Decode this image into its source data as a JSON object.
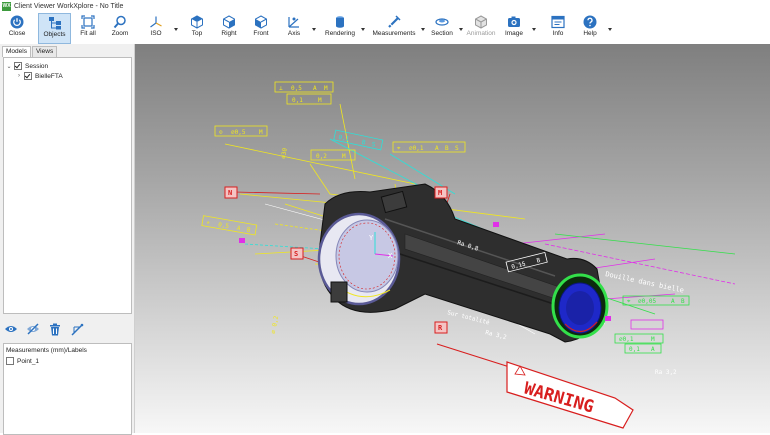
{
  "window": {
    "title": "Client Viewer WorkXplore - No Title",
    "logo_text": "WX"
  },
  "toolbar": {
    "close": "Close",
    "objects": "Objects",
    "fit_all": "Fit all",
    "zoom": "Zoom",
    "iso": "ISO",
    "top": "Top",
    "right": "Right",
    "front": "Front",
    "axis": "Axis",
    "rendering": "Rendering",
    "measurements": "Measurements",
    "section": "Section",
    "animation": "Animation",
    "image": "Image",
    "info": "Info",
    "help": "Help"
  },
  "left_panel": {
    "tabs": [
      "Models",
      "Views"
    ],
    "tree": [
      {
        "label": "Session",
        "checked": true
      },
      {
        "label": "BielleFTA",
        "checked": true
      }
    ],
    "measurements_header": "Measurements (mm)/Labels",
    "measurements": [
      {
        "label": "Point_1",
        "checked": false
      }
    ]
  },
  "viewport": {
    "labels": {
      "datum_n": "N",
      "datum_m": "M",
      "datum_s": "S",
      "datum_r": "R",
      "fcf1_a": "⊥",
      "fcf1_b": "0,5",
      "fcf1_c": "A",
      "fcf1_d": "M",
      "fcf2_a": "0,1",
      "fcf2_b": "M",
      "fcf3_a": "⊙",
      "fcf3_b": "⌀0,5",
      "fcf3_c": "M",
      "fcf4_a": "0,2",
      "fcf4_b": "M",
      "fcf5_a": "⌖",
      "fcf5_b": "⌀0,1",
      "fcf5_c": "A",
      "fcf5_d": "B",
      "fcf5_e": "S",
      "fcf6_a": "⌖",
      "fcf6_b": "0,5",
      "fcf6_c": "A",
      "fcf6_d": "B",
      "fcf7_a": "0,1",
      "fcf7_b": "B",
      "fcf7_c": "S",
      "fcf8_a": "0,15",
      "fcf8_b": "B",
      "fcf9_a": "⌖",
      "fcf9_b": "⌀0,05",
      "fcf9_c": "A",
      "fcf9_d": "B",
      "fcf10_a": "⌀0,1",
      "fcf10_b": "M",
      "fcf11_a": "0,1",
      "fcf11_b": "A",
      "dim1": "⌀30",
      "dim2": "Ra 3,2",
      "dim3": "Ra 3,2",
      "dim4": "Ra 0,8",
      "dim5": "⌀ 0,2",
      "note1": "Douille dans bielle",
      "note2": "Sur totalité",
      "axis_y": "Y",
      "axis_x": "X",
      "warning": "WARNING"
    }
  },
  "colors": {
    "toolbar_icon": "#2c72c0",
    "active_button": "#cfe4f7",
    "annotation_yellow": "#f0e620",
    "annotation_cyan": "#2de0d8",
    "annotation_green": "#33e04a",
    "annotation_magenta": "#e030e8",
    "datum_red": "#d81e1e",
    "part_dark": "#2e2e2e",
    "bore_blue": "#1e28c8"
  }
}
